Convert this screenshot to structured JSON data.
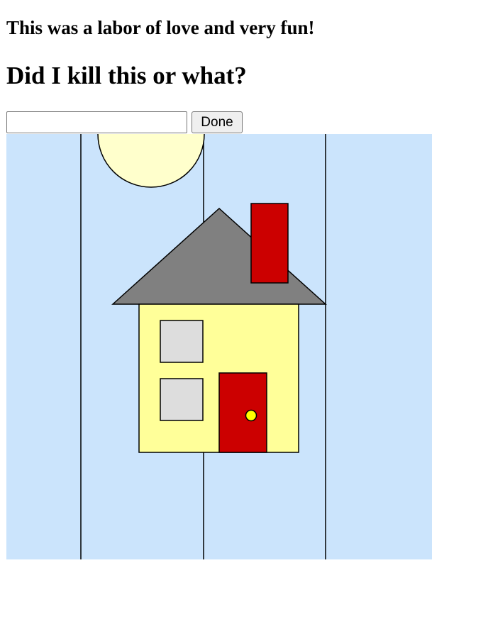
{
  "heading_small": "This was a labor of love and very fun!",
  "heading_large": "Did I kill this or what?",
  "form": {
    "input_value": "",
    "input_placeholder": "",
    "done_label": "Done"
  },
  "scene": {
    "sky_color": "#cbe4fc",
    "sun_color": "#ffffcc",
    "roof_color": "#808080",
    "chimney_color": "#cc0000",
    "wall_color": "#ffff99",
    "window_color": "#dddddd",
    "door_color": "#cc0000",
    "doorknob_color": "#ffff00",
    "outline_color": "#000000"
  }
}
